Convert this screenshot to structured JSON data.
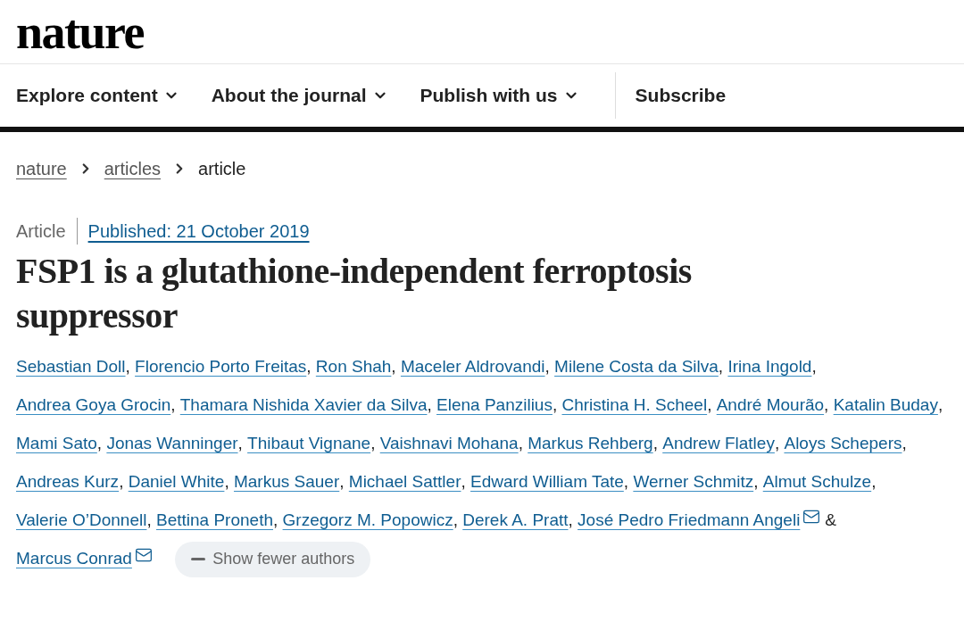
{
  "logo": "nature",
  "nav": [
    {
      "label": "Explore content",
      "dropdown": true
    },
    {
      "label": "About the journal",
      "dropdown": true
    },
    {
      "label": "Publish with us",
      "dropdown": true
    },
    {
      "label": "Subscribe",
      "dropdown": false
    }
  ],
  "breadcrumb": [
    {
      "label": "nature",
      "link": true
    },
    {
      "label": "articles",
      "link": true
    },
    {
      "label": "article",
      "link": false
    }
  ],
  "article_type": "Article",
  "published": "Published: 21 October 2019",
  "title": "FSP1 is a glutathione-independent ferroptosis suppressor",
  "authors": [
    {
      "name": "Sebastian Doll",
      "email": false,
      "separator": ","
    },
    {
      "name": "Florencio Porto Freitas",
      "email": false,
      "separator": ","
    },
    {
      "name": "Ron Shah",
      "email": false,
      "separator": ","
    },
    {
      "name": "Maceler Aldrovandi",
      "email": false,
      "separator": ","
    },
    {
      "name": "Milene Costa da Silva",
      "email": false,
      "separator": ","
    },
    {
      "name": "Irina Ingold",
      "email": false,
      "separator": ","
    },
    {
      "name": "Andrea Goya Grocin",
      "email": false,
      "separator": ","
    },
    {
      "name": "Thamara Nishida Xavier da Silva",
      "email": false,
      "separator": ","
    },
    {
      "name": "Elena Panzilius",
      "email": false,
      "separator": ","
    },
    {
      "name": "Christina H. Scheel",
      "email": false,
      "separator": ","
    },
    {
      "name": "André Mourão",
      "email": false,
      "separator": ","
    },
    {
      "name": "Katalin Buday",
      "email": false,
      "separator": ","
    },
    {
      "name": "Mami Sato",
      "email": false,
      "separator": ","
    },
    {
      "name": "Jonas Wanninger",
      "email": false,
      "separator": ","
    },
    {
      "name": "Thibaut Vignane",
      "email": false,
      "separator": ","
    },
    {
      "name": "Vaishnavi Mohana",
      "email": false,
      "separator": ","
    },
    {
      "name": "Markus Rehberg",
      "email": false,
      "separator": ","
    },
    {
      "name": "Andrew Flatley",
      "email": false,
      "separator": ","
    },
    {
      "name": "Aloys Schepers",
      "email": false,
      "separator": ","
    },
    {
      "name": "Andreas Kurz",
      "email": false,
      "separator": ","
    },
    {
      "name": "Daniel White",
      "email": false,
      "separator": ","
    },
    {
      "name": "Markus Sauer",
      "email": false,
      "separator": ","
    },
    {
      "name": "Michael Sattler",
      "email": false,
      "separator": ","
    },
    {
      "name": "Edward William Tate",
      "email": false,
      "separator": ","
    },
    {
      "name": "Werner Schmitz",
      "email": false,
      "separator": ","
    },
    {
      "name": "Almut Schulze",
      "email": false,
      "separator": ","
    },
    {
      "name": "Valerie O’Donnell",
      "email": false,
      "separator": ","
    },
    {
      "name": "Bettina Proneth",
      "email": false,
      "separator": ","
    },
    {
      "name": "Grzegorz M. Popowicz",
      "email": false,
      "separator": ","
    },
    {
      "name": "Derek A. Pratt",
      "email": false,
      "separator": ","
    },
    {
      "name": "José Pedro Friedmann Angeli",
      "email": true,
      "separator": "&"
    },
    {
      "name": "Marcus Conrad",
      "email": true
    }
  ],
  "toggle_authors": {
    "label": "Show fewer authors",
    "expanded": true
  }
}
